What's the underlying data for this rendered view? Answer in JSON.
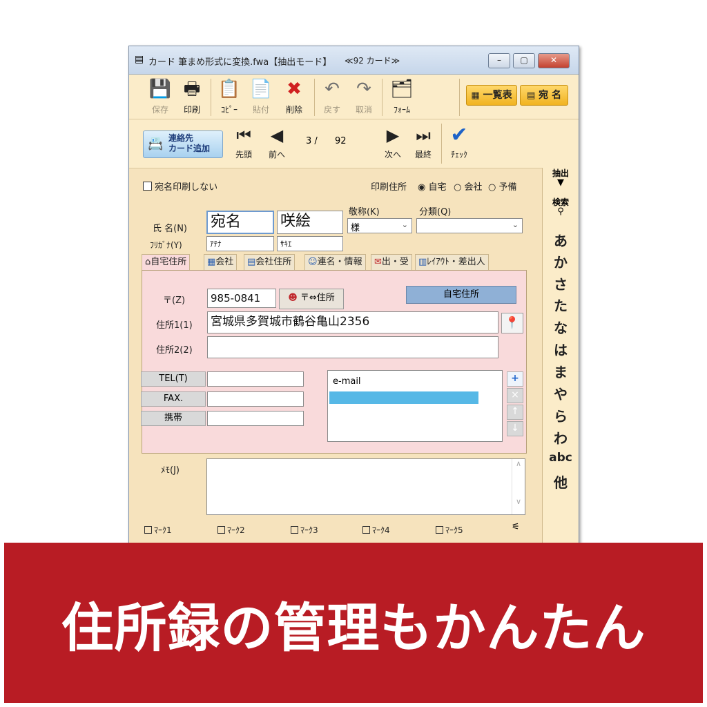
{
  "window": {
    "title": "カード 筆まめ形式に変換.fwa【抽出モード】",
    "card_count": "≪92 カード≫",
    "controls": [
      "–",
      "▢",
      "✕"
    ]
  },
  "toolbar": {
    "buttons": [
      {
        "label": "保存",
        "icon": "save-icon",
        "enabled": false
      },
      {
        "label": "印刷",
        "icon": "print-icon",
        "enabled": true
      },
      {
        "label": "ｺﾋﾟｰ",
        "icon": "copy-icon",
        "enabled": true
      },
      {
        "label": "貼付",
        "icon": "paste-icon",
        "enabled": false
      },
      {
        "label": "削除",
        "icon": "delete-icon",
        "enabled": true
      },
      {
        "label": "戻す",
        "icon": "undo-icon",
        "enabled": false
      },
      {
        "label": "取消",
        "icon": "redo-icon",
        "enabled": false
      },
      {
        "label": "ﾌｫｰﾑ",
        "icon": "form-icon",
        "enabled": true
      }
    ],
    "list_button": "一覧表",
    "address_button": "宛 名"
  },
  "nav": {
    "add_contact": "連絡先\nカード追加",
    "first": "先頭",
    "prev": "前へ",
    "position": "3 /",
    "total": "92",
    "next": "次へ",
    "last": "最終",
    "check": "ﾁｪｯｸ"
  },
  "form": {
    "no_print_label": "宛名印刷しない",
    "print_address_label": "印刷住所",
    "print_options": [
      "自宅",
      "会社",
      "予備"
    ],
    "print_selected": "自宅",
    "name_label": "氏 名(N)",
    "furigana_label": "ﾌﾘｶﾞﾅ(Y)",
    "last_name": "宛名",
    "first_name": "咲絵",
    "last_kana": "ｱﾃﾅ",
    "first_kana": "ｻｷｴ",
    "honorific_label": "敬称(K)",
    "honorific_value": "様",
    "category_label": "分類(Q)",
    "category_value": ""
  },
  "tabs": [
    "自宅住所",
    "会社",
    "会社住所",
    "連名・情報",
    "出・受",
    "ﾚｲｱｳﾄ・差出人"
  ],
  "address": {
    "zip_label": "〒(Z)",
    "zip_value": "985-0841",
    "zip_convert": "〒⇔住所",
    "panel_title": "自宅住所",
    "addr1_label": "住所1(1)",
    "addr1_value": "宮城県多賀城市鶴谷亀山2356",
    "addr2_label": "住所2(2)",
    "addr2_value": "",
    "tel_label": "TEL(T)",
    "fax_label": "FAX.",
    "mobile_label": "携帯",
    "email_items": [
      "e-mail",
      ""
    ],
    "side_buttons": [
      "+",
      "×",
      "↑",
      "↓"
    ]
  },
  "memo_label": "ﾒﾓ(J)",
  "marks": [
    "ﾏｰｸ1",
    "ﾏｰｸ2",
    "ﾏｰｸ3",
    "ﾏｰｸ4",
    "ﾏｰｸ5"
  ],
  "index": {
    "extract": "抽出",
    "search": "検索",
    "kana": [
      "あ",
      "か",
      "さ",
      "た",
      "な",
      "は",
      "ま",
      "や",
      "ら",
      "わ",
      "abc",
      "他"
    ]
  },
  "banner": {
    "text": "住所録の管理もかんたん",
    "color": "#b81c24"
  }
}
